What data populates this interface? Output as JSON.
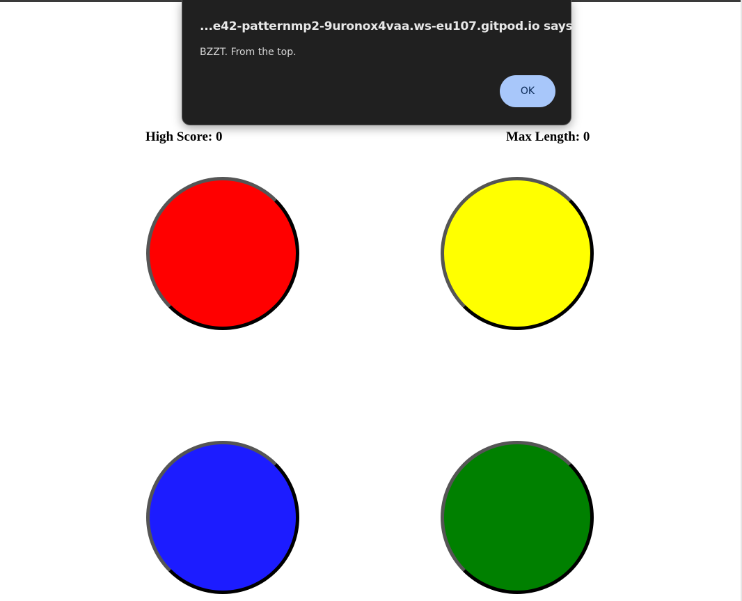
{
  "alert": {
    "title": "...e42-patternmp2-9uronox4vaa.ws-eu107.gitpod.io says",
    "message": "BZZT. From the top.",
    "ok_label": "OK"
  },
  "scoreboard": {
    "high_score": "High Score: 0",
    "max_length": "Max Length: 0"
  },
  "buttons": [
    {
      "name": "red",
      "color": "#ff0000"
    },
    {
      "name": "yellow",
      "color": "#ffff00"
    },
    {
      "name": "blue",
      "color": "#1c1cff"
    },
    {
      "name": "green",
      "color": "#008000"
    }
  ]
}
